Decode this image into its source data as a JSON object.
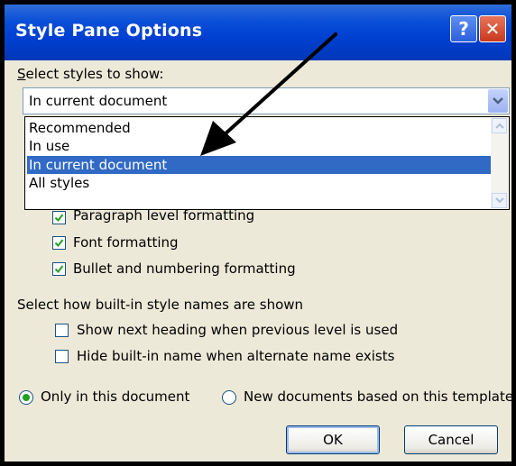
{
  "window": {
    "title": "Style Pane Options",
    "help_icon": "?",
    "close_icon": "✕"
  },
  "select_styles": {
    "label": "Select styles to show:",
    "current_value": "In current document",
    "options": [
      "Recommended",
      "In use",
      "In current document",
      "All styles"
    ],
    "selected_index": 2
  },
  "formatting": {
    "paragraph": "Paragraph level formatting",
    "font": "Font formatting",
    "bullets": "Bullet and numbering formatting"
  },
  "builtin": {
    "heading": "Select how built-in style names are shown",
    "show_next": "Show next heading when previous level is used",
    "hide_builtin": "Hide built-in name when alternate name exists"
  },
  "scope": {
    "only_this": "Only in this document",
    "new_docs": "New documents based on this template"
  },
  "buttons": {
    "ok": "OK",
    "cancel": "Cancel"
  },
  "colors": {
    "title_bar": "#0a4fd8",
    "selection": "#316ac5",
    "dialog_bg": "#ece9d8",
    "check": "#21a121"
  }
}
